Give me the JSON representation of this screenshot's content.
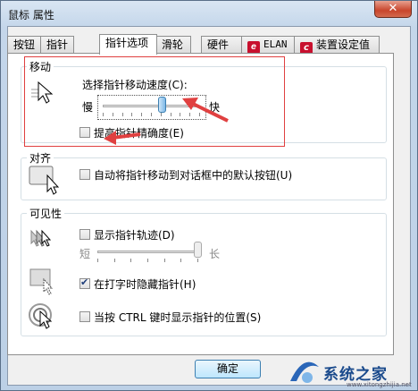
{
  "window": {
    "title": "鼠标 属性",
    "close_glyph": "✕"
  },
  "tabs": [
    {
      "label": "按钮"
    },
    {
      "label": "指针"
    },
    {
      "label": "指针选项"
    },
    {
      "label": "滑轮"
    },
    {
      "label": "硬件"
    },
    {
      "label": "ELAN",
      "icon": "elan-logo-icon"
    },
    {
      "label": "装置设定值",
      "icon": "device-settings-icon"
    }
  ],
  "active_tab": "指针选项",
  "motion": {
    "title": "移动",
    "speed_label": "选择指针移动速度(C):",
    "slow": "慢",
    "fast": "快",
    "speed_level": 0.62,
    "precision_label": "提高指针精确度(E)",
    "precision_checked": false
  },
  "snap": {
    "title": "对齐",
    "snap_label": "自动将指针移动到对话框中的默认按钮(U)",
    "snap_checked": false
  },
  "visibility": {
    "title": "可见性",
    "trails_label": "显示指针轨迹(D)",
    "trails_checked": false,
    "short": "短",
    "long": "长",
    "trails_level": 1.0,
    "hide_label": "在打字时隐藏指针(H)",
    "hide_checked": true,
    "ctrl_label": "当按 CTRL 键时显示指针的位置(S)",
    "ctrl_checked": false
  },
  "buttons": {
    "ok": "确定"
  },
  "watermark": {
    "text": "系统之家",
    "sub": "www.xitongzhijia.net"
  },
  "colors": {
    "annotation_red": "#e04040",
    "accent_blue": "#3c7fb1"
  }
}
